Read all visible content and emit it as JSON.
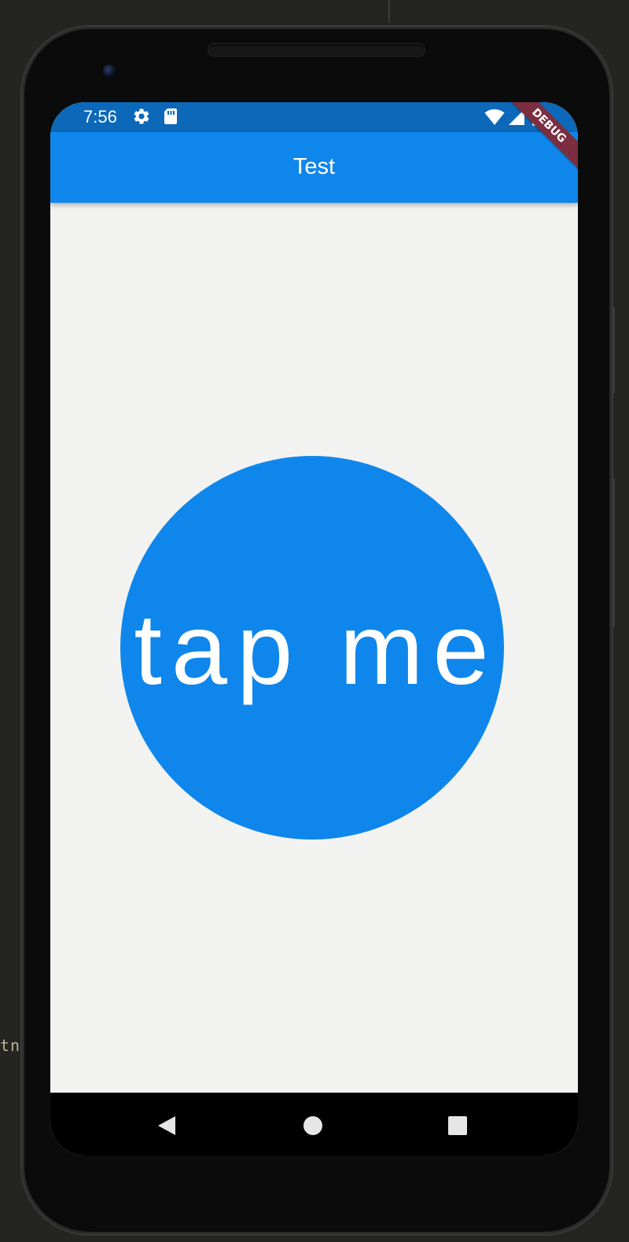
{
  "background_code_text": "tn",
  "status_bar": {
    "time": "7:56",
    "icons": [
      "gear-icon",
      "sd-card-icon",
      "wifi-icon",
      "signal-icon",
      "battery-icon"
    ]
  },
  "app_bar": {
    "title": "Test"
  },
  "main": {
    "button_label": "tap me"
  },
  "debug_banner": "DEBUG",
  "nav_bar": {
    "icons": [
      "back-icon",
      "home-icon",
      "recents-icon"
    ]
  },
  "colors": {
    "status_bar": "#0c68b9",
    "app_bar": "#0f86eb",
    "circle_button": "#0f86eb",
    "content_background": "#f2f2f0",
    "debug_banner": "#7a2e40",
    "nav_bar": "#000000"
  }
}
